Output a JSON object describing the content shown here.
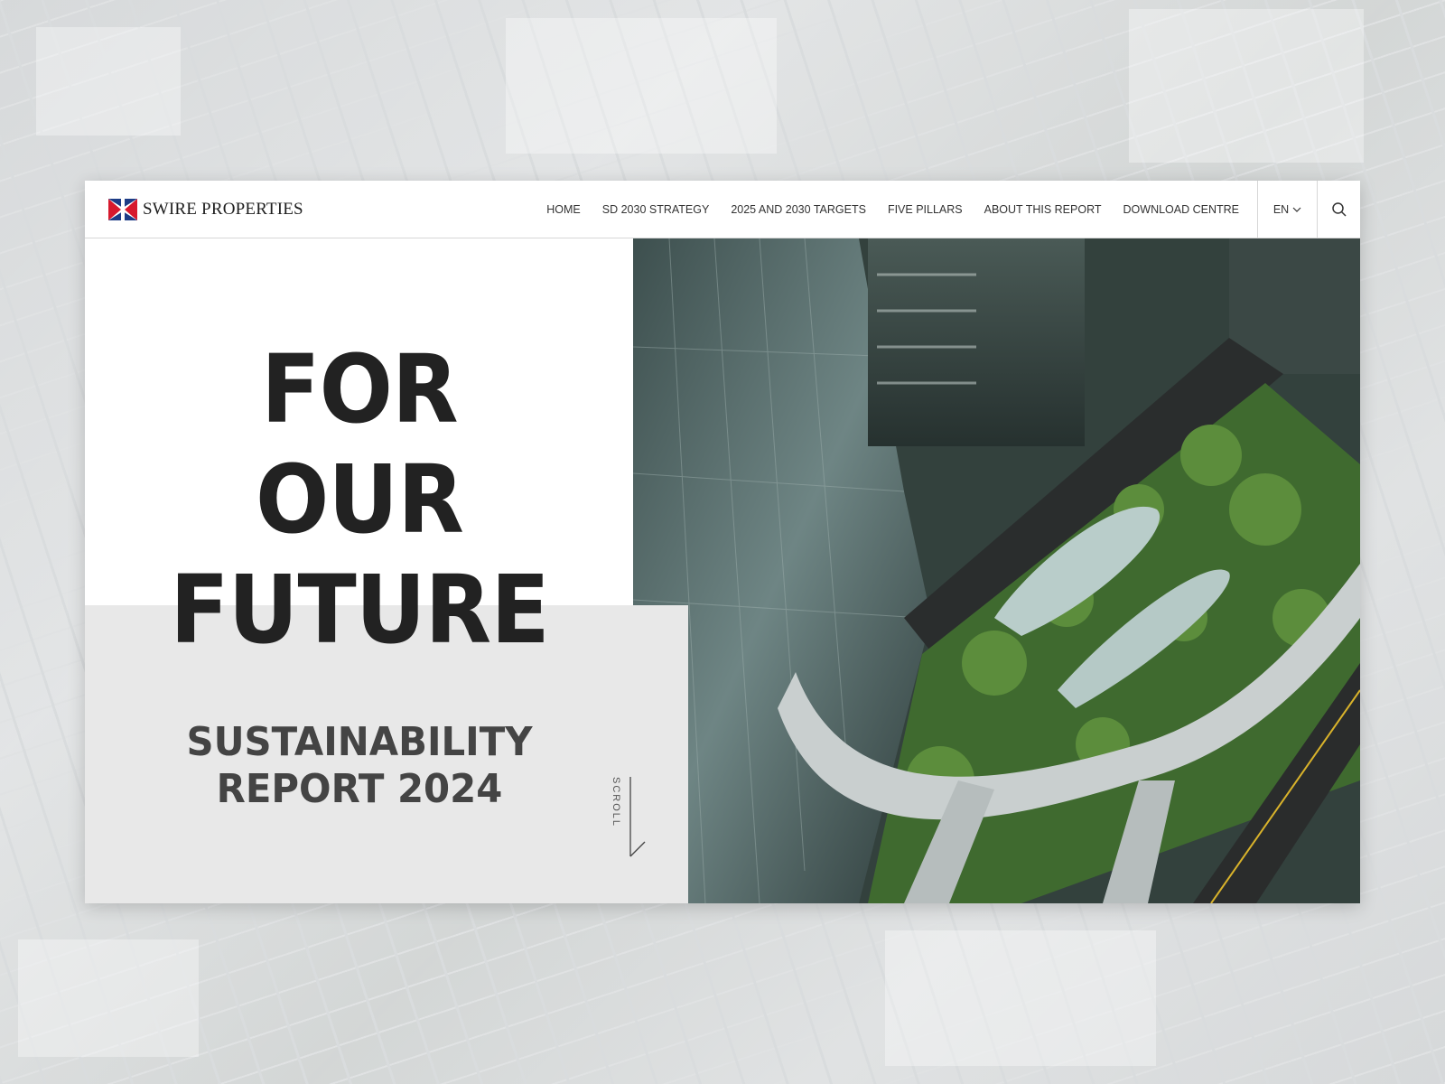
{
  "header": {
    "logo_text": "SWIRE PROPERTIES",
    "nav": [
      {
        "label": "HOME"
      },
      {
        "label": "SD 2030 STRATEGY"
      },
      {
        "label": "2025 AND 2030 TARGETS"
      },
      {
        "label": "FIVE PILLARS"
      },
      {
        "label": "ABOUT THIS REPORT"
      },
      {
        "label": "DOWNLOAD CENTRE"
      }
    ],
    "language": "EN",
    "icons": {
      "language": "chevron-down-icon",
      "search": "search-icon",
      "logo": "swire-flag-logo"
    }
  },
  "hero": {
    "headline": [
      "FOR",
      "OUR",
      "FUTURE"
    ],
    "subtitle": [
      "SUSTAINABILITY",
      "REPORT 2024"
    ],
    "scroll_label": "SCROLL"
  },
  "colors": {
    "headline": "#222222",
    "subtitle": "#444444",
    "grey_block": "#e8e8e8",
    "logo_red": "#d7192d",
    "logo_blue": "#1d3c86"
  }
}
